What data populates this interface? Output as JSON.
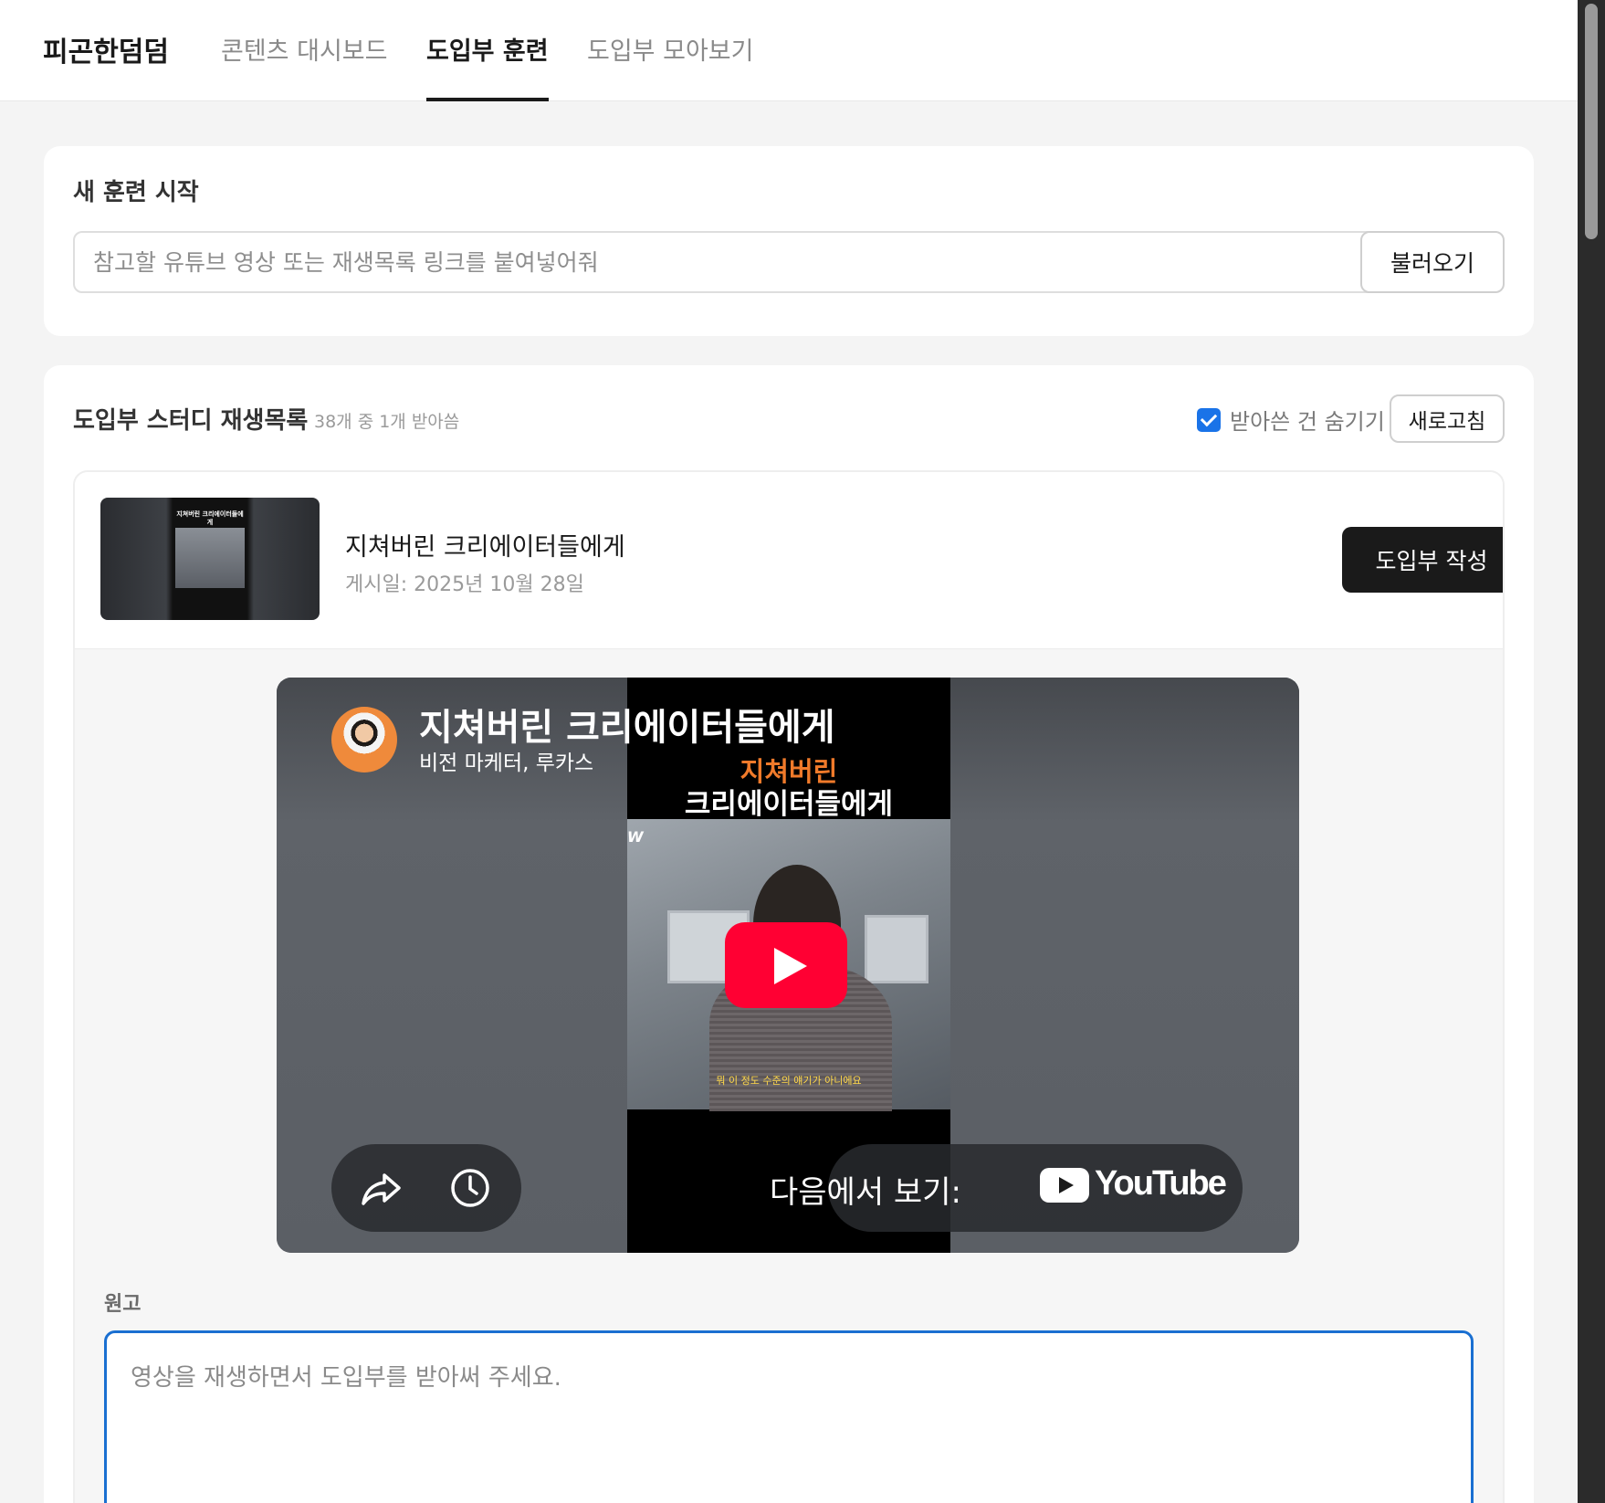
{
  "nav": {
    "brand": "피곤한덤덤",
    "tabs": [
      {
        "label": "콘텐츠 대시보드",
        "active": false
      },
      {
        "label": "도입부 훈련",
        "active": true
      },
      {
        "label": "도입부 모아보기",
        "active": false
      }
    ]
  },
  "new_training": {
    "title": "새 훈련 시작",
    "input_placeholder": "참고할 유튜브 영상 또는 재생목록 링크를 붙여넣어줘",
    "input_value": "",
    "load_button": "불러오기"
  },
  "playlist": {
    "title": "도입부 스터디 재생목록",
    "count": "38개 중 1개 받아씀",
    "hide_label": "받아쓴 건 숨기기",
    "hide_checked": true,
    "refresh_button": "새로고침",
    "video": {
      "title": "지쳐버린 크리에이터들에게",
      "date": "게시일: 2025년 10월 28일",
      "write_button": "도입부 작성",
      "thumbnail_caption": "지쳐버린 크리에이터들에게"
    }
  },
  "player": {
    "title": "지쳐버린 크리에이터들에게",
    "channel": "비전 마케터, 루카스",
    "overlay_line1": "지쳐버린",
    "overlay_line2": "크리에이터들에게",
    "overlay_mark": "W",
    "subtitle": "뭐 이 정도 수준의 얘기가 아니에요",
    "watch_on": "다음에서 보기:",
    "youtube_logo": "YouTube",
    "icons": [
      "share-icon",
      "watch-later-icon",
      "play-icon"
    ],
    "play_color": "#ff0033"
  },
  "script": {
    "label": "원고",
    "placeholder": "영상을 재생하면서 도입부를 받아써 주세요.",
    "value": ""
  },
  "colors": {
    "accent": "#1a73e8",
    "primary_button": "#1a1a1a"
  }
}
